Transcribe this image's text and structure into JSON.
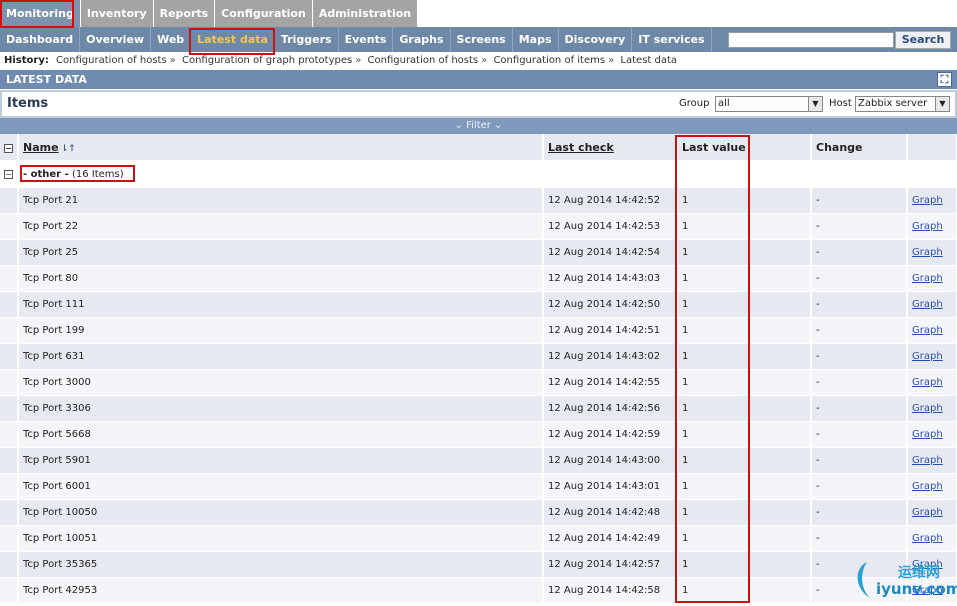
{
  "top_menu": [
    "Monitoring",
    "Inventory",
    "Reports",
    "Configuration",
    "Administration"
  ],
  "sub_menu": [
    "Dashboard",
    "Overview",
    "Web",
    "Latest data",
    "Triggers",
    "Events",
    "Graphs",
    "Screens",
    "Maps",
    "Discovery",
    "IT services"
  ],
  "search": {
    "value": "",
    "button": "Search"
  },
  "history": {
    "label": "History:",
    "items": [
      "Configuration of hosts",
      "Configuration of graph prototypes",
      "Configuration of hosts",
      "Configuration of items",
      "Latest data"
    ],
    "separator": "»"
  },
  "section_title": "LATEST DATA",
  "items_title": "Items",
  "filters": {
    "group_label": "Group",
    "group_value": "all",
    "host_label": "Host",
    "host_value": "Zabbix server",
    "filter_toggle": "Filter"
  },
  "table": {
    "columns": {
      "name": "Name",
      "last_check": "Last check",
      "last_value": "Last value",
      "change": "Change"
    },
    "group_row": {
      "name": "- other -",
      "count": "(16 Items)"
    },
    "rows": [
      {
        "name": "Tcp Port 21",
        "last_check": "12 Aug 2014 14:42:52",
        "last_value": "1",
        "change": "-",
        "action": "Graph"
      },
      {
        "name": "Tcp Port 22",
        "last_check": "12 Aug 2014 14:42:53",
        "last_value": "1",
        "change": "-",
        "action": "Graph"
      },
      {
        "name": "Tcp Port 25",
        "last_check": "12 Aug 2014 14:42:54",
        "last_value": "1",
        "change": "-",
        "action": "Graph"
      },
      {
        "name": "Tcp Port 80",
        "last_check": "12 Aug 2014 14:43:03",
        "last_value": "1",
        "change": "-",
        "action": "Graph"
      },
      {
        "name": "Tcp Port 111",
        "last_check": "12 Aug 2014 14:42:50",
        "last_value": "1",
        "change": "-",
        "action": "Graph"
      },
      {
        "name": "Tcp Port 199",
        "last_check": "12 Aug 2014 14:42:51",
        "last_value": "1",
        "change": "-",
        "action": "Graph"
      },
      {
        "name": "Tcp Port 631",
        "last_check": "12 Aug 2014 14:43:02",
        "last_value": "1",
        "change": "-",
        "action": "Graph"
      },
      {
        "name": "Tcp Port 3000",
        "last_check": "12 Aug 2014 14:42:55",
        "last_value": "1",
        "change": "-",
        "action": "Graph"
      },
      {
        "name": "Tcp Port 3306",
        "last_check": "12 Aug 2014 14:42:56",
        "last_value": "1",
        "change": "-",
        "action": "Graph"
      },
      {
        "name": "Tcp Port 5668",
        "last_check": "12 Aug 2014 14:42:59",
        "last_value": "1",
        "change": "-",
        "action": "Graph"
      },
      {
        "name": "Tcp Port 5901",
        "last_check": "12 Aug 2014 14:43:00",
        "last_value": "1",
        "change": "-",
        "action": "Graph"
      },
      {
        "name": "Tcp Port 6001",
        "last_check": "12 Aug 2014 14:43:01",
        "last_value": "1",
        "change": "-",
        "action": "Graph"
      },
      {
        "name": "Tcp Port 10050",
        "last_check": "12 Aug 2014 14:42:48",
        "last_value": "1",
        "change": "-",
        "action": "Graph"
      },
      {
        "name": "Tcp Port 10051",
        "last_check": "12 Aug 2014 14:42:49",
        "last_value": "1",
        "change": "-",
        "action": "Graph"
      },
      {
        "name": "Tcp Port 35365",
        "last_check": "12 Aug 2014 14:42:57",
        "last_value": "1",
        "change": "-",
        "action": "Graph"
      },
      {
        "name": "Tcp Port 42953",
        "last_check": "12 Aug 2014 14:42:58",
        "last_value": "1",
        "change": "-",
        "action": "Graph"
      }
    ]
  },
  "watermark": {
    "line1": "运维网",
    "line2": "iyunv.com"
  },
  "colors": {
    "menu_active": "#7d93ad",
    "submenu_bg": "#6e88a8",
    "highlight": "#d01010",
    "active_sub": "#f7c848"
  }
}
